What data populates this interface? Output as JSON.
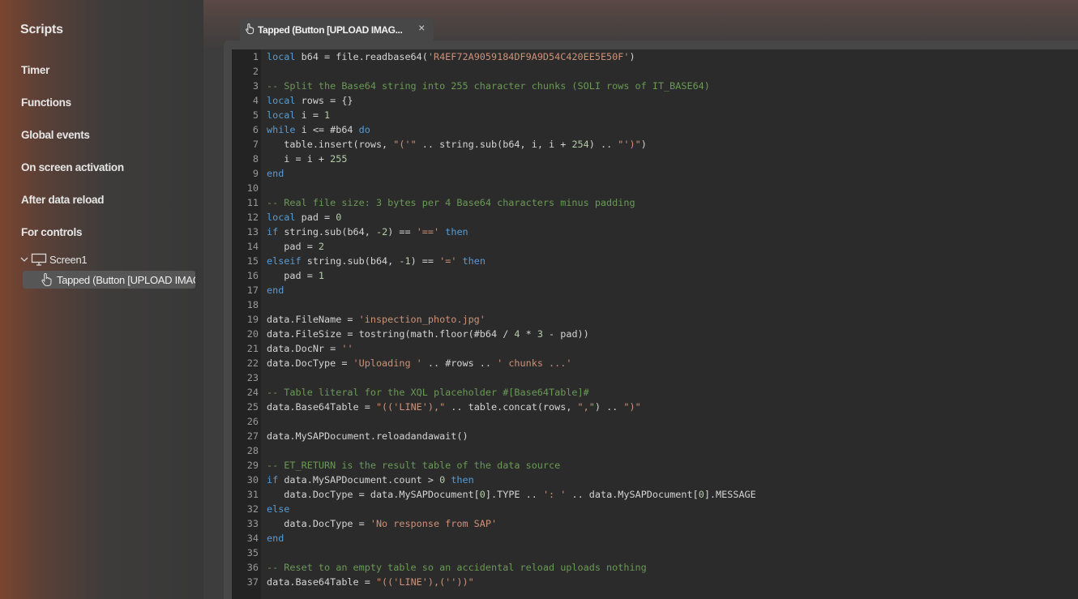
{
  "sidebar": {
    "title": "Scripts",
    "items": [
      "Timer",
      "Functions",
      "Global events",
      "On screen activation",
      "After data reload",
      "For controls"
    ],
    "tree": {
      "screen_label": "Screen1",
      "selected_label": "Tapped (Button [UPLOAD IMAGE])"
    }
  },
  "tab": {
    "label": "Tapped (Button [UPLOAD IMAG...",
    "close": "×"
  },
  "code": {
    "lines": [
      [
        [
          "kw",
          "local"
        ],
        [
          "t",
          " b64 = file.readbase64("
        ],
        [
          "str",
          "'R4EF72A9059184DF9A9D54C420EE5E50F'"
        ],
        [
          "t",
          ")"
        ]
      ],
      [],
      [
        [
          "cm",
          "-- Split the Base64 string into 255 character chunks (SOLI rows of IT_BASE64)"
        ]
      ],
      [
        [
          "kw",
          "local"
        ],
        [
          "t",
          " rows = {}"
        ]
      ],
      [
        [
          "kw",
          "local"
        ],
        [
          "t",
          " i = "
        ],
        [
          "num",
          "1"
        ]
      ],
      [
        [
          "kw",
          "while"
        ],
        [
          "t",
          " i <= #b64 "
        ],
        [
          "kw",
          "do"
        ]
      ],
      [
        [
          "t",
          "   table.insert(rows, "
        ],
        [
          "str",
          "\"('\""
        ],
        [
          "t",
          " .. string.sub(b64, i, i + "
        ],
        [
          "num",
          "254"
        ],
        [
          "t",
          ") .. "
        ],
        [
          "str",
          "\"')\""
        ],
        [
          "t",
          ")"
        ]
      ],
      [
        [
          "t",
          "   i = i + "
        ],
        [
          "num",
          "255"
        ]
      ],
      [
        [
          "kw",
          "end"
        ]
      ],
      [],
      [
        [
          "cm",
          "-- Real file size: 3 bytes per 4 Base64 characters minus padding"
        ]
      ],
      [
        [
          "kw",
          "local"
        ],
        [
          "t",
          " pad = "
        ],
        [
          "num",
          "0"
        ]
      ],
      [
        [
          "kw",
          "if"
        ],
        [
          "t",
          " string.sub(b64, "
        ],
        [
          "num",
          "-2"
        ],
        [
          "t",
          ") == "
        ],
        [
          "str",
          "'=='"
        ],
        [
          "t",
          " "
        ],
        [
          "kw",
          "then"
        ]
      ],
      [
        [
          "t",
          "   pad = "
        ],
        [
          "num",
          "2"
        ]
      ],
      [
        [
          "kw",
          "elseif"
        ],
        [
          "t",
          " string.sub(b64, "
        ],
        [
          "num",
          "-1"
        ],
        [
          "t",
          ") == "
        ],
        [
          "str",
          "'='"
        ],
        [
          "t",
          " "
        ],
        [
          "kw",
          "then"
        ]
      ],
      [
        [
          "t",
          "   pad = "
        ],
        [
          "num",
          "1"
        ]
      ],
      [
        [
          "kw",
          "end"
        ]
      ],
      [],
      [
        [
          "t",
          "data.FileName = "
        ],
        [
          "str",
          "'inspection_photo.jpg'"
        ]
      ],
      [
        [
          "t",
          "data.FileSize = tostring(math.floor(#b64 / "
        ],
        [
          "num",
          "4"
        ],
        [
          "t",
          " * "
        ],
        [
          "num",
          "3"
        ],
        [
          "t",
          " - pad))"
        ]
      ],
      [
        [
          "t",
          "data.DocNr = "
        ],
        [
          "str",
          "''"
        ]
      ],
      [
        [
          "t",
          "data.DocType = "
        ],
        [
          "str",
          "'Uploading '"
        ],
        [
          "t",
          " .. #rows .. "
        ],
        [
          "str",
          "' chunks ...'"
        ]
      ],
      [],
      [
        [
          "cm",
          "-- Table literal for the XQL placeholder #[Base64Table]#"
        ]
      ],
      [
        [
          "t",
          "data.Base64Table = "
        ],
        [
          "str",
          "\"(('LINE'),\""
        ],
        [
          "t",
          " .. table.concat(rows, "
        ],
        [
          "str",
          "\",\""
        ],
        [
          "t",
          ") .. "
        ],
        [
          "str",
          "\")\""
        ]
      ],
      [],
      [
        [
          "t",
          "data.MySAPDocument.reloadandawait()"
        ]
      ],
      [],
      [
        [
          "cm",
          "-- ET_RETURN is the result table of the data source"
        ]
      ],
      [
        [
          "kw",
          "if"
        ],
        [
          "t",
          " data.MySAPDocument.count > "
        ],
        [
          "num",
          "0"
        ],
        [
          "t",
          " "
        ],
        [
          "kw",
          "then"
        ]
      ],
      [
        [
          "t",
          "   data.DocType = data.MySAPDocument["
        ],
        [
          "num",
          "0"
        ],
        [
          "t",
          "].TYPE .. "
        ],
        [
          "str",
          "': '"
        ],
        [
          "t",
          " .. data.MySAPDocument["
        ],
        [
          "num",
          "0"
        ],
        [
          "t",
          "].MESSAGE"
        ]
      ],
      [
        [
          "kw",
          "else"
        ]
      ],
      [
        [
          "t",
          "   data.DocType = "
        ],
        [
          "str",
          "'No response from SAP'"
        ]
      ],
      [
        [
          "kw",
          "end"
        ]
      ],
      [],
      [
        [
          "cm",
          "-- Reset to an empty table so an accidental reload uploads nothing"
        ]
      ],
      [
        [
          "t",
          "data.Base64Table = "
        ],
        [
          "str",
          "\"(('LINE'),(''))\""
        ]
      ]
    ]
  }
}
